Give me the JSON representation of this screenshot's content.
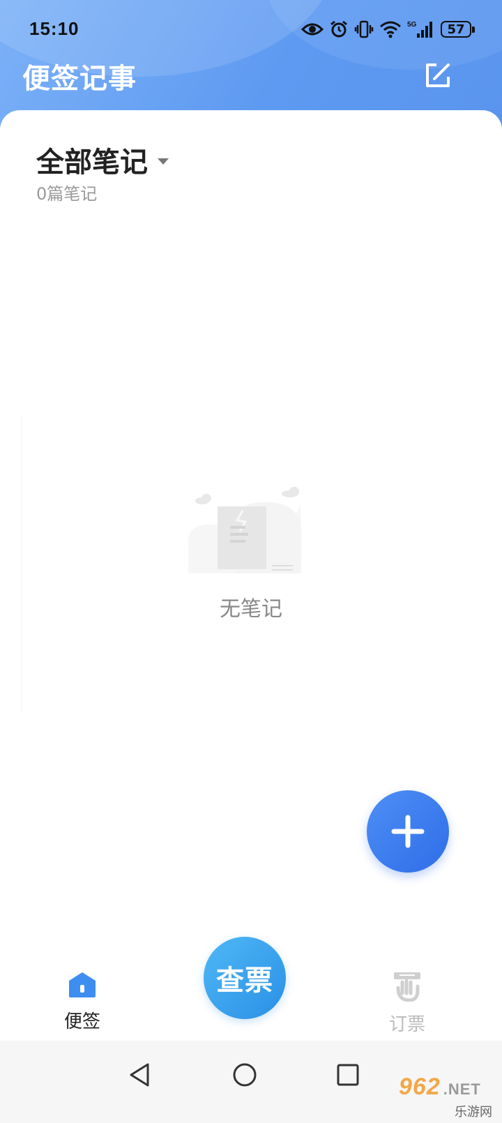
{
  "status_bar": {
    "time": "15:10",
    "battery": "57",
    "network": "5G"
  },
  "header": {
    "title": "便签记事",
    "edit_icon": "edit-icon"
  },
  "folder": {
    "title": "全部笔记",
    "count": "0篇笔记"
  },
  "empty_state": {
    "text": "无笔记",
    "illustration": "empty-notes-illustration"
  },
  "fab": {
    "icon": "plus-icon"
  },
  "bottom_nav": {
    "home_label": "便签",
    "center_label": "查票",
    "ticket_label": "订票"
  },
  "system_nav": {
    "back": "back-icon",
    "home": "home-icon",
    "recents": "recents-icon"
  },
  "watermark": {
    "brand": "962",
    "suffix": ".NET",
    "site": "乐游网"
  },
  "colors": {
    "header_blue": "#5e9af1",
    "fab_blue": "#2f6de8",
    "center_button_blue": "#2a8fe6"
  }
}
